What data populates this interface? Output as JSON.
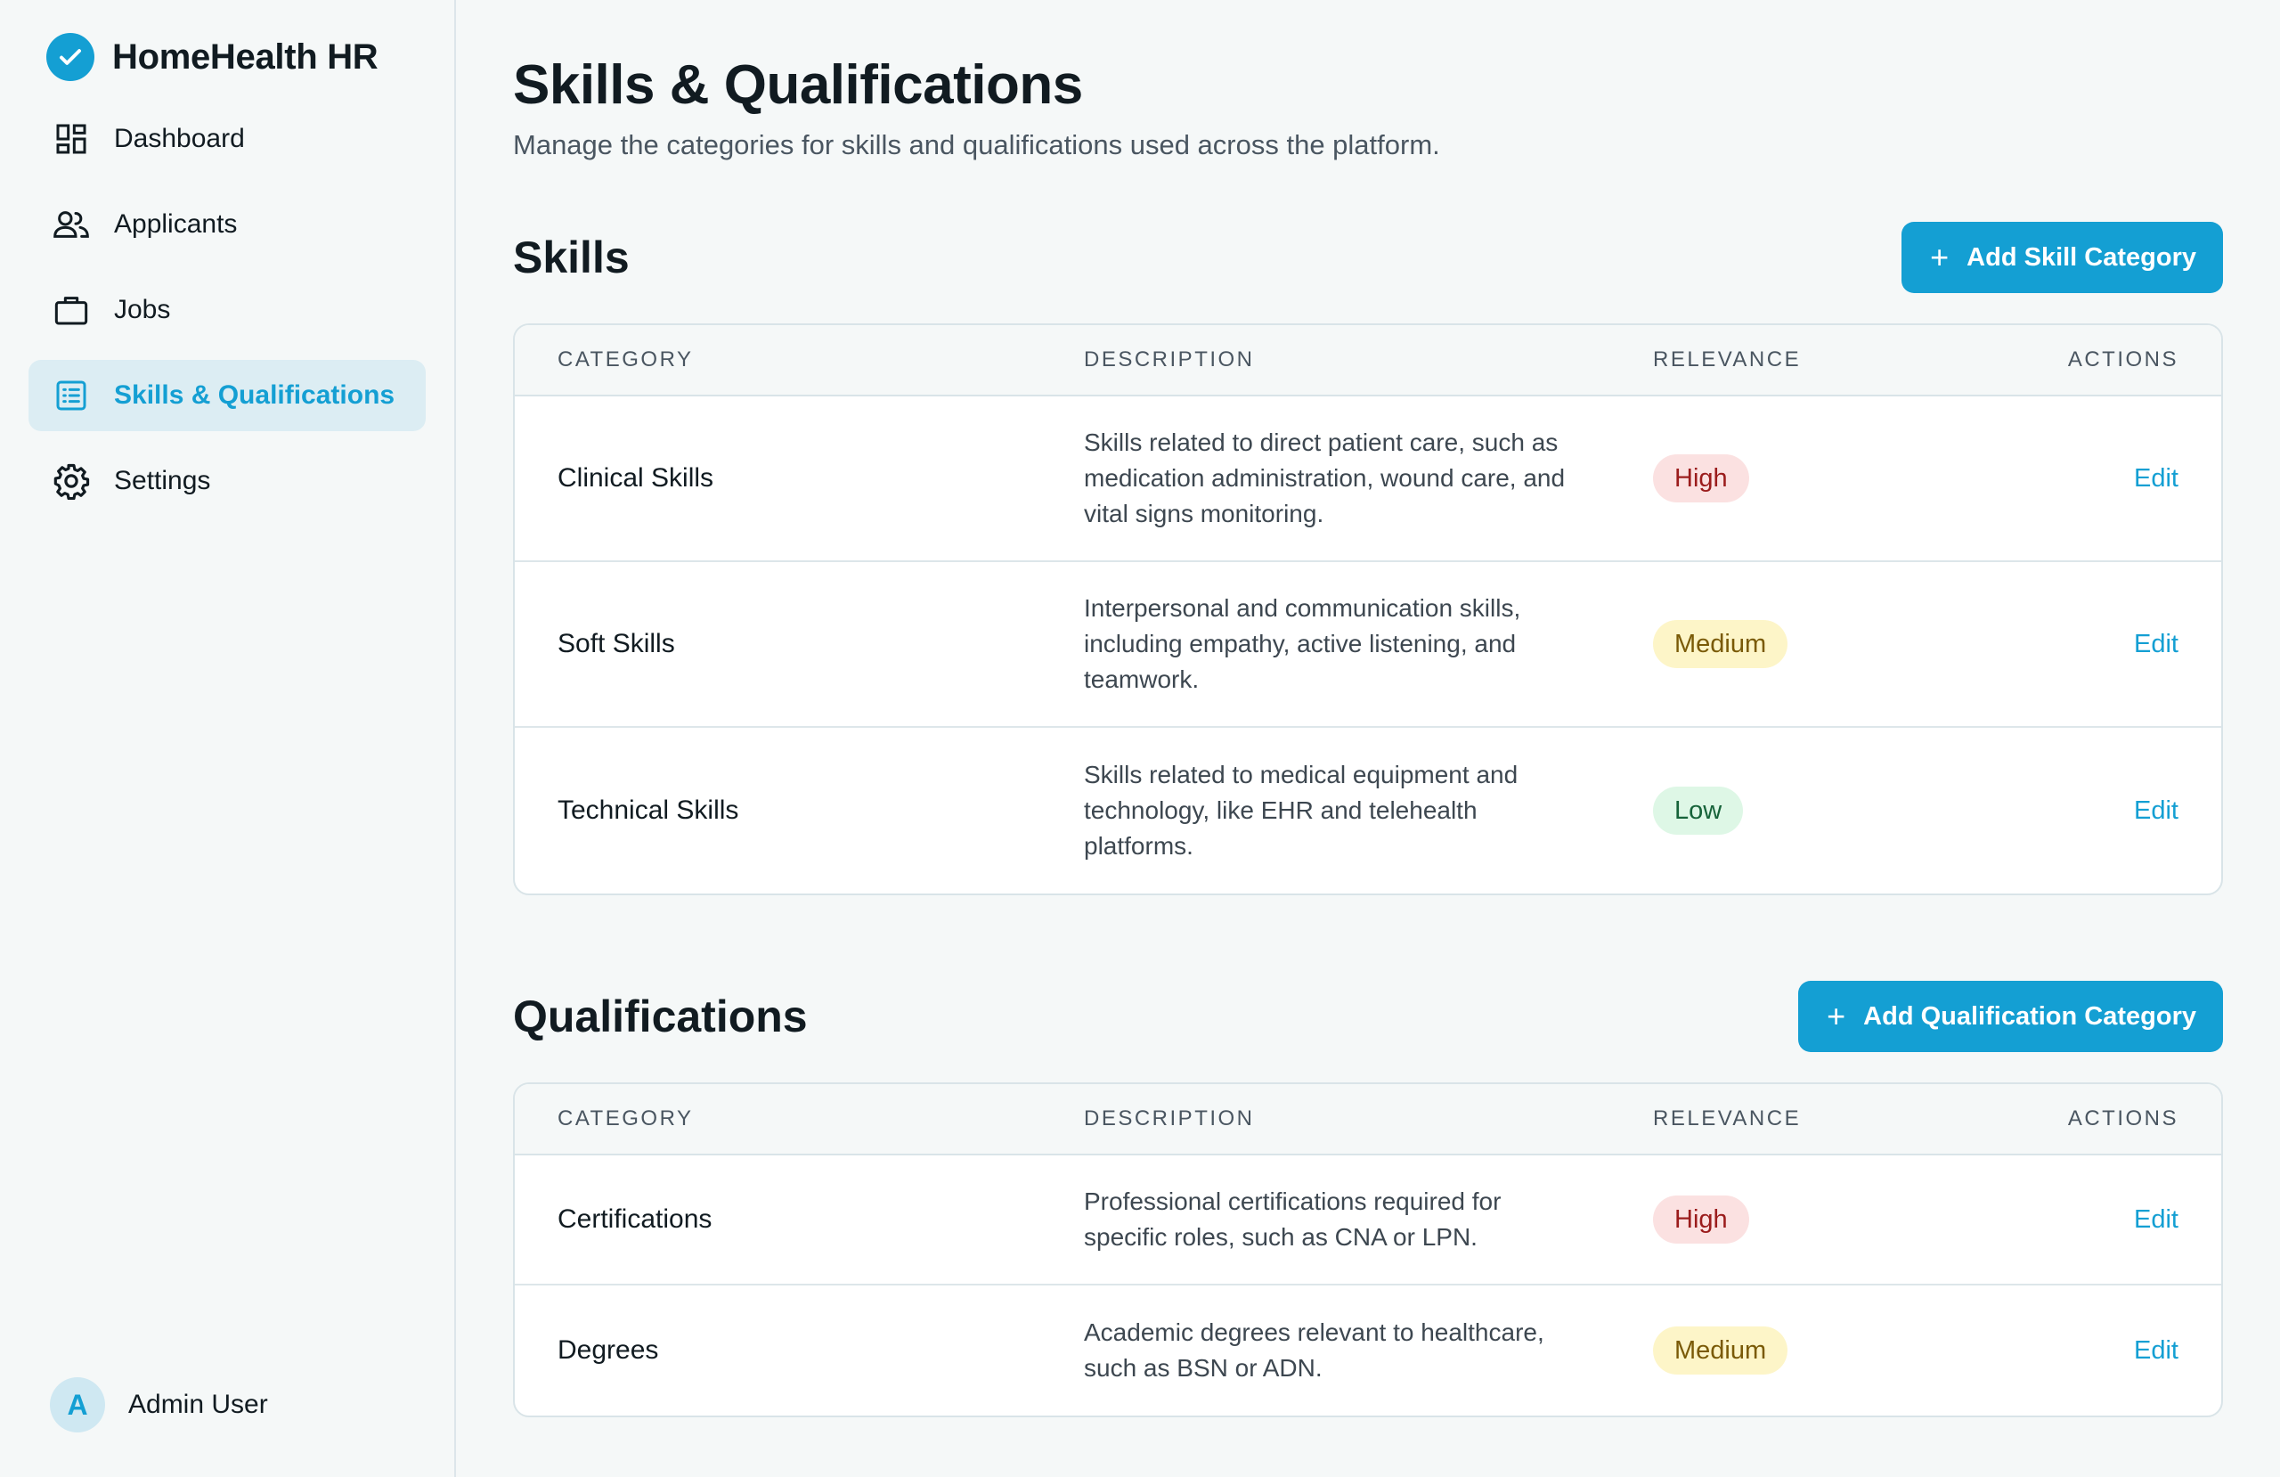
{
  "app": {
    "name": "HomeHealth HR"
  },
  "sidebar": {
    "items": [
      {
        "label": "Dashboard",
        "icon": "dashboard-icon",
        "active": false
      },
      {
        "label": "Applicants",
        "icon": "users-icon",
        "active": false
      },
      {
        "label": "Jobs",
        "icon": "briefcase-icon",
        "active": false
      },
      {
        "label": "Skills & Qualifications",
        "icon": "list-icon",
        "active": true
      },
      {
        "label": "Settings",
        "icon": "gear-icon",
        "active": false
      }
    ],
    "user": {
      "initial": "A",
      "name": "Admin User"
    }
  },
  "page": {
    "title": "Skills & Qualifications",
    "subtitle": "Manage the categories for skills and qualifications used across the platform."
  },
  "skills": {
    "title": "Skills",
    "add_label": "Add Skill Category",
    "headers": {
      "category": "CATEGORY",
      "description": "DESCRIPTION",
      "relevance": "RELEVANCE",
      "actions": "ACTIONS"
    },
    "rows": [
      {
        "category": "Clinical Skills",
        "description": "Skills related to direct patient care, such as medication administration, wound care, and vital signs monitoring.",
        "relevance": "High",
        "action": "Edit"
      },
      {
        "category": "Soft Skills",
        "description": "Interpersonal and communication skills, including empathy, active listening, and teamwork.",
        "relevance": "Medium",
        "action": "Edit"
      },
      {
        "category": "Technical Skills",
        "description": "Skills related to medical equipment and technology, like EHR and telehealth platforms.",
        "relevance": "Low",
        "action": "Edit"
      }
    ]
  },
  "qualifications": {
    "title": "Qualifications",
    "add_label": "Add Qualification Category",
    "headers": {
      "category": "CATEGORY",
      "description": "DESCRIPTION",
      "relevance": "RELEVANCE",
      "actions": "ACTIONS"
    },
    "rows": [
      {
        "category": "Certifications",
        "description": "Professional certifications required for specific roles, such as CNA or LPN.",
        "relevance": "High",
        "action": "Edit"
      },
      {
        "category": "Degrees",
        "description": "Academic degrees relevant to healthcare, such as BSN or ADN.",
        "relevance": "Medium",
        "action": "Edit"
      }
    ]
  },
  "colors": {
    "accent": "#149fd3",
    "high_bg": "#fbe1e1",
    "high_fg": "#9b1c1c",
    "medium_bg": "#fdf5c8",
    "medium_fg": "#7a5a07",
    "low_bg": "#def7e6",
    "low_fg": "#17633a"
  }
}
